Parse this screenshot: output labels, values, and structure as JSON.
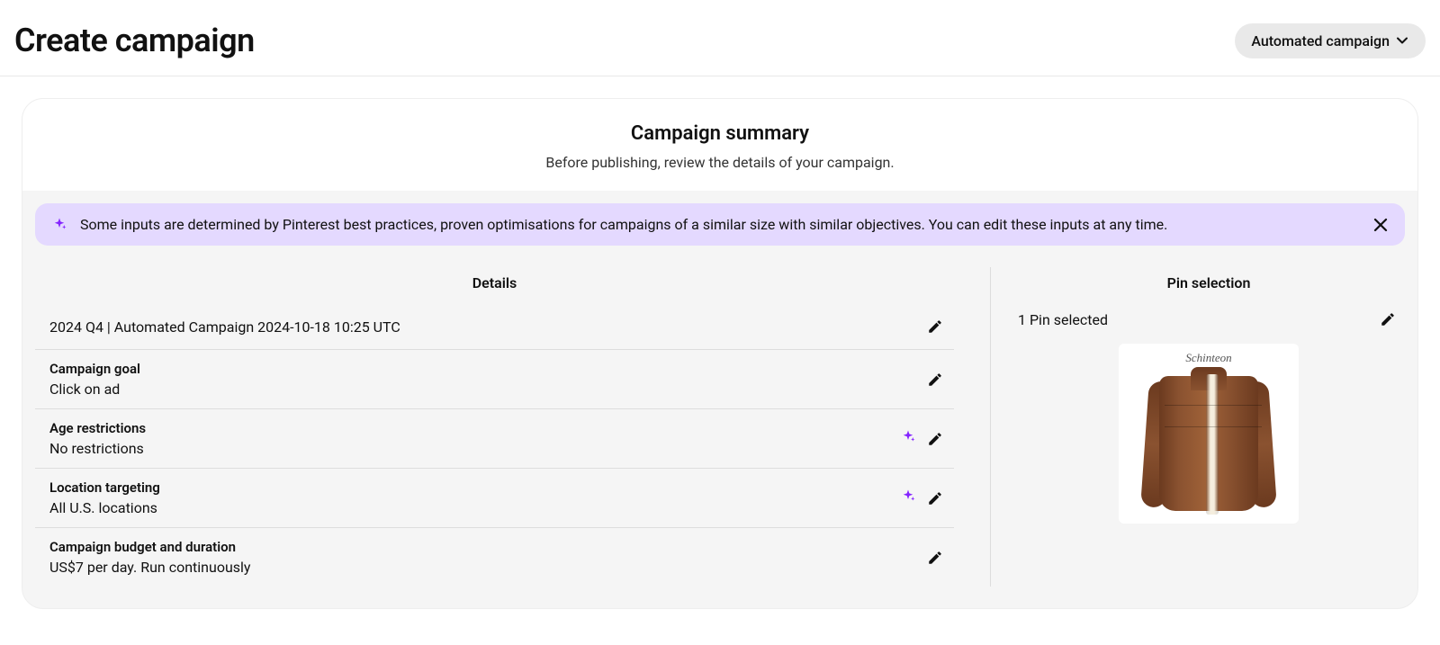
{
  "header": {
    "title": "Create campaign",
    "campaign_type_label": "Automated campaign"
  },
  "summary": {
    "title": "Campaign summary",
    "subtitle": "Before publishing, review the details of your campaign."
  },
  "banner": {
    "text": "Some inputs are determined by Pinterest best practices, proven optimisations for campaigns of a similar size with similar objectives. You can edit these inputs at any time."
  },
  "details": {
    "heading": "Details",
    "rows": [
      {
        "label": "",
        "value": "2024 Q4 | Automated Campaign 2024-10-18 10:25 UTC",
        "auto": false
      },
      {
        "label": "Campaign goal",
        "value": "Click on ad",
        "auto": false
      },
      {
        "label": "Age restrictions",
        "value": "No restrictions",
        "auto": true
      },
      {
        "label": "Location targeting",
        "value": "All U.S. locations",
        "auto": true
      },
      {
        "label": "Campaign budget and duration",
        "value": "US$7 per day. Run continuously",
        "auto": false
      }
    ]
  },
  "pins": {
    "heading": "Pin selection",
    "selected_text": "1 Pin selected",
    "brand_text": "Schinteon"
  },
  "colors": {
    "sparkle": "#8424ff",
    "banner_bg": "#e4d9ff"
  }
}
